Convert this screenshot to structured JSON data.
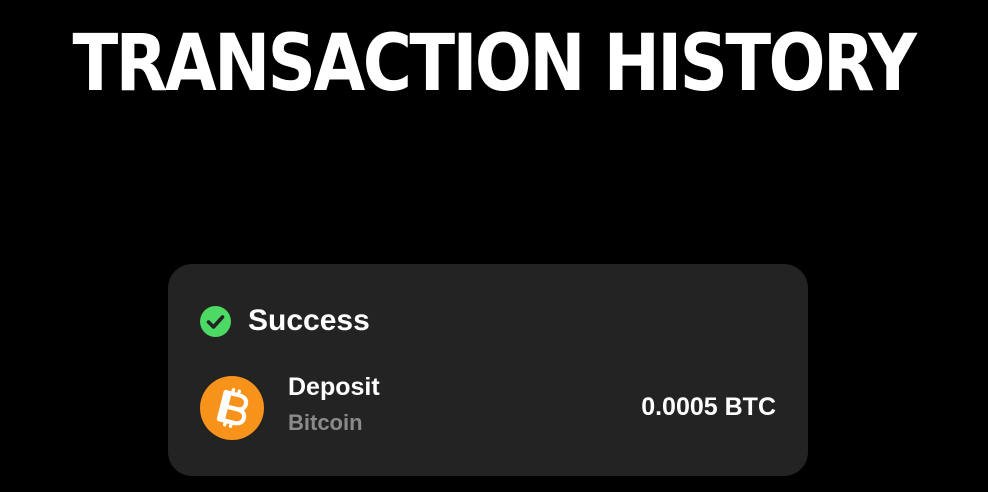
{
  "page": {
    "title": "TRANSACTION HISTORY"
  },
  "transaction": {
    "status": "Success",
    "status_icon": "check-circle-icon",
    "type": "Deposit",
    "asset_name": "Bitcoin",
    "asset_icon": "bitcoin-icon",
    "amount": "0.0005 BTC"
  },
  "colors": {
    "background": "#000000",
    "card": "#232323",
    "success": "#4cd964",
    "bitcoin": "#f7931a",
    "muted_text": "#8a8a8a"
  }
}
